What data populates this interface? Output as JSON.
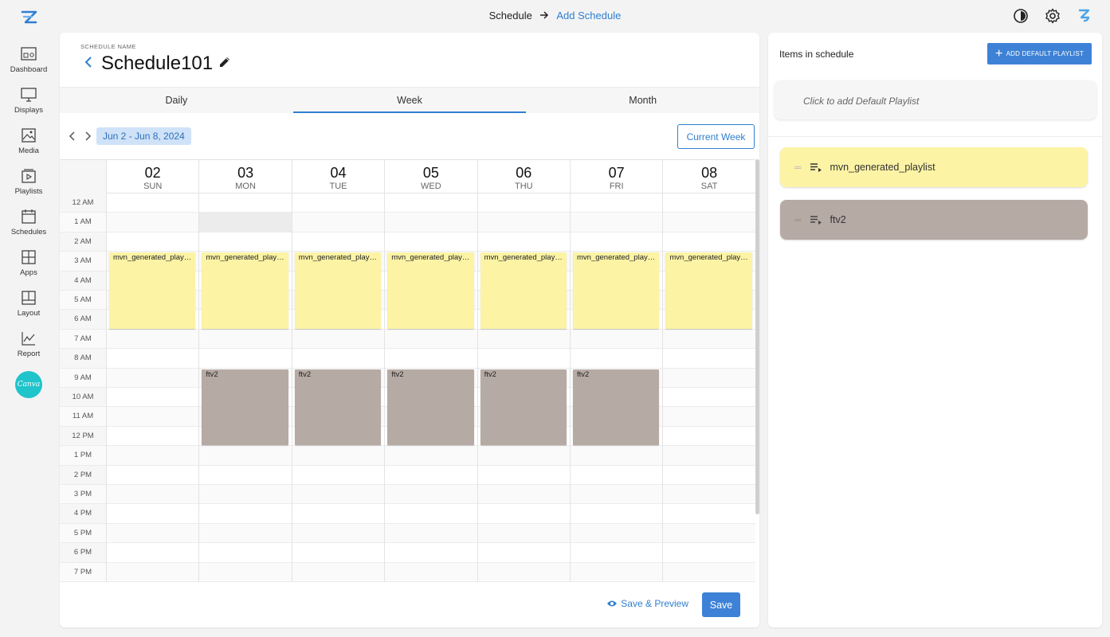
{
  "topbar": {
    "crumb_parent": "Schedule",
    "crumb_current": "Add Schedule"
  },
  "sidebar": {
    "items": [
      {
        "label": "Dashboard",
        "icon": "dashboard-icon"
      },
      {
        "label": "Displays",
        "icon": "monitor-icon"
      },
      {
        "label": "Media",
        "icon": "image-icon"
      },
      {
        "label": "Playlists",
        "icon": "playlist-icon"
      },
      {
        "label": "Schedules",
        "icon": "calendar-icon"
      },
      {
        "label": "Apps",
        "icon": "apps-icon"
      },
      {
        "label": "Layout",
        "icon": "layout-icon"
      },
      {
        "label": "Report",
        "icon": "chart-icon"
      }
    ],
    "canva_label": "Canva"
  },
  "schedule": {
    "label": "SCHEDULE NAME",
    "name": "Schedule101"
  },
  "tabs": [
    {
      "label": "Daily",
      "active": false
    },
    {
      "label": "Week",
      "active": true
    },
    {
      "label": "Month",
      "active": false
    }
  ],
  "week": {
    "range": "Jun 2 - Jun 8, 2024",
    "current_week_label": "Current Week",
    "days": [
      {
        "num": "02",
        "dow": "SUN"
      },
      {
        "num": "03",
        "dow": "MON"
      },
      {
        "num": "04",
        "dow": "TUE"
      },
      {
        "num": "05",
        "dow": "WED"
      },
      {
        "num": "06",
        "dow": "THU"
      },
      {
        "num": "07",
        "dow": "FRI"
      },
      {
        "num": "08",
        "dow": "SAT"
      }
    ],
    "hours": [
      "12 AM",
      "1 AM",
      "2 AM",
      "3 AM",
      "4 AM",
      "5 AM",
      "6 AM",
      "7 AM",
      "8 AM",
      "9 AM",
      "10 AM",
      "11 AM",
      "12 PM",
      "1 PM",
      "2 PM",
      "3 PM",
      "4 PM",
      "5 PM",
      "6 PM",
      "7 PM"
    ],
    "events": [
      {
        "title": "mvn_generated_playlist",
        "color": "#fcf3a5",
        "days": [
          0,
          1,
          2,
          3,
          4,
          5,
          6
        ],
        "start": 3,
        "end": 7
      },
      {
        "title": "ftv2",
        "color": "#b6aaa4",
        "days": [
          1,
          2,
          3,
          4,
          5
        ],
        "start": 9,
        "end": 13
      }
    ]
  },
  "footer": {
    "save_preview": "Save & Preview",
    "save": "Save"
  },
  "right": {
    "title": "Items in schedule",
    "add_default": "ADD DEFAULT PLAYLIST",
    "default_hint": "Click to add Default Playlist",
    "playlists": [
      {
        "name": "mvn_generated_playlist",
        "color": "#fcf3a5"
      },
      {
        "name": "ftv2",
        "color": "#b6aaa4"
      }
    ]
  },
  "colors": {
    "accent": "#2f7fd0",
    "button": "#3d82d6",
    "event_yellow": "#fcf3a5",
    "event_brown": "#b6aaa4"
  }
}
